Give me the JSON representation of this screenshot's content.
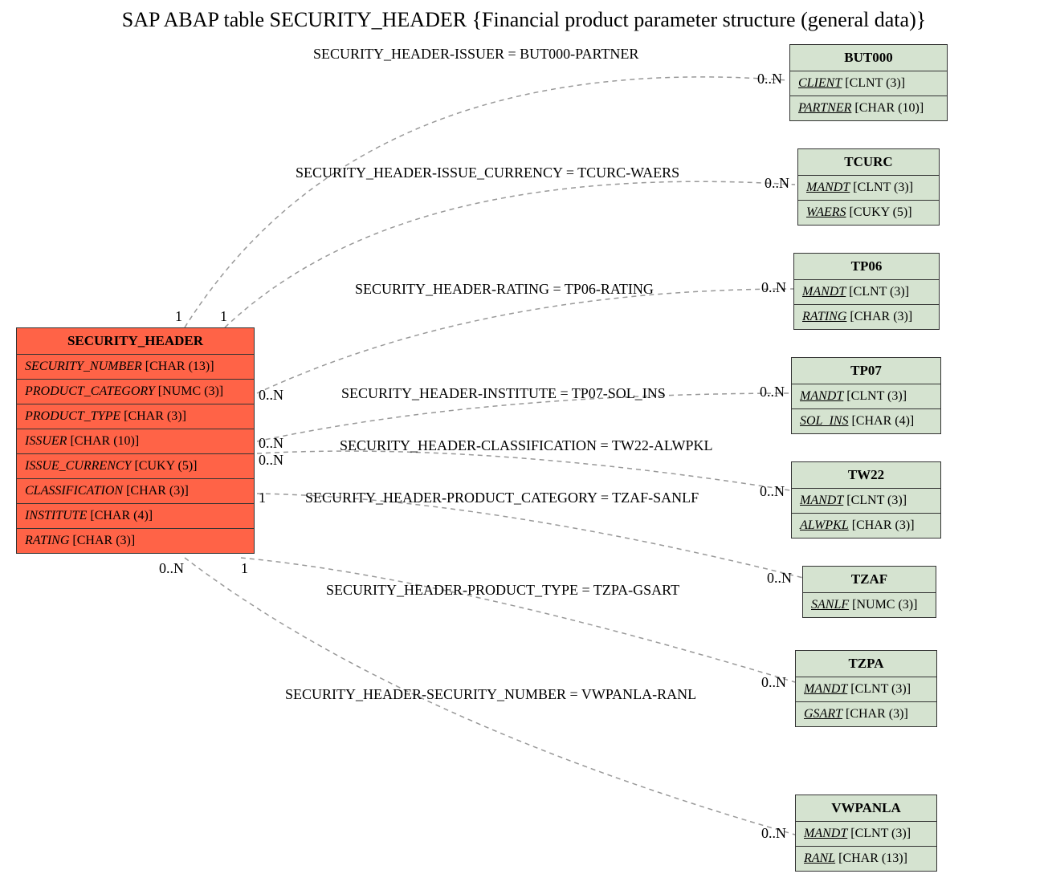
{
  "title": "SAP ABAP table SECURITY_HEADER {Financial product parameter structure (general data)}",
  "primary": {
    "name": "SECURITY_HEADER",
    "fields": [
      {
        "name": "SECURITY_NUMBER",
        "type": "[CHAR (13)]"
      },
      {
        "name": "PRODUCT_CATEGORY",
        "type": "[NUMC (3)]"
      },
      {
        "name": "PRODUCT_TYPE",
        "type": "[CHAR (3)]"
      },
      {
        "name": "ISSUER",
        "type": "[CHAR (10)]"
      },
      {
        "name": "ISSUE_CURRENCY",
        "type": "[CUKY (5)]"
      },
      {
        "name": "CLASSIFICATION",
        "type": "[CHAR (3)]"
      },
      {
        "name": "INSTITUTE",
        "type": "[CHAR (4)]"
      },
      {
        "name": "RATING",
        "type": "[CHAR (3)]"
      }
    ]
  },
  "related": [
    {
      "name": "BUT000",
      "fields": [
        {
          "name": "CLIENT",
          "type": "[CLNT (3)]"
        },
        {
          "name": "PARTNER",
          "type": "[CHAR (10)]"
        }
      ]
    },
    {
      "name": "TCURC",
      "fields": [
        {
          "name": "MANDT",
          "type": "[CLNT (3)]"
        },
        {
          "name": "WAERS",
          "type": "[CUKY (5)]"
        }
      ]
    },
    {
      "name": "TP06",
      "fields": [
        {
          "name": "MANDT",
          "type": "[CLNT (3)]"
        },
        {
          "name": "RATING",
          "type": "[CHAR (3)]"
        }
      ]
    },
    {
      "name": "TP07",
      "fields": [
        {
          "name": "MANDT",
          "type": "[CLNT (3)]"
        },
        {
          "name": "SOL_INS",
          "type": "[CHAR (4)]"
        }
      ]
    },
    {
      "name": "TW22",
      "fields": [
        {
          "name": "MANDT",
          "type": "[CLNT (3)]"
        },
        {
          "name": "ALWPKL",
          "type": "[CHAR (3)]"
        }
      ]
    },
    {
      "name": "TZAF",
      "fields": [
        {
          "name": "SANLF",
          "type": "[NUMC (3)]"
        }
      ]
    },
    {
      "name": "TZPA",
      "fields": [
        {
          "name": "MANDT",
          "type": "[CLNT (3)]"
        },
        {
          "name": "GSART",
          "type": "[CHAR (3)]"
        }
      ]
    },
    {
      "name": "VWPANLA",
      "fields": [
        {
          "name": "MANDT",
          "type": "[CLNT (3)]"
        },
        {
          "name": "RANL",
          "type": "[CHAR (13)]"
        }
      ]
    }
  ],
  "relations": [
    {
      "label": "SECURITY_HEADER-ISSUER = BUT000-PARTNER",
      "left_card": "1",
      "right_card": "0..N"
    },
    {
      "label": "SECURITY_HEADER-ISSUE_CURRENCY = TCURC-WAERS",
      "left_card": "1",
      "right_card": "0..N"
    },
    {
      "label": "SECURITY_HEADER-RATING = TP06-RATING",
      "left_card": "0..N",
      "right_card": "0..N"
    },
    {
      "label": "SECURITY_HEADER-INSTITUTE = TP07-SOL_INS",
      "left_card": "0..N",
      "right_card": "0..N"
    },
    {
      "label": "SECURITY_HEADER-CLASSIFICATION = TW22-ALWPKL",
      "left_card": "0..N",
      "right_card": "0..N"
    },
    {
      "label": "SECURITY_HEADER-PRODUCT_CATEGORY = TZAF-SANLF",
      "left_card": "1",
      "right_card": "0..N"
    },
    {
      "label": "SECURITY_HEADER-PRODUCT_TYPE = TZPA-GSART",
      "left_card": "1",
      "right_card": "0..N"
    },
    {
      "label": "SECURITY_HEADER-SECURITY_NUMBER = VWPANLA-RANL",
      "left_card": "0..N",
      "right_card": "0..N"
    }
  ]
}
